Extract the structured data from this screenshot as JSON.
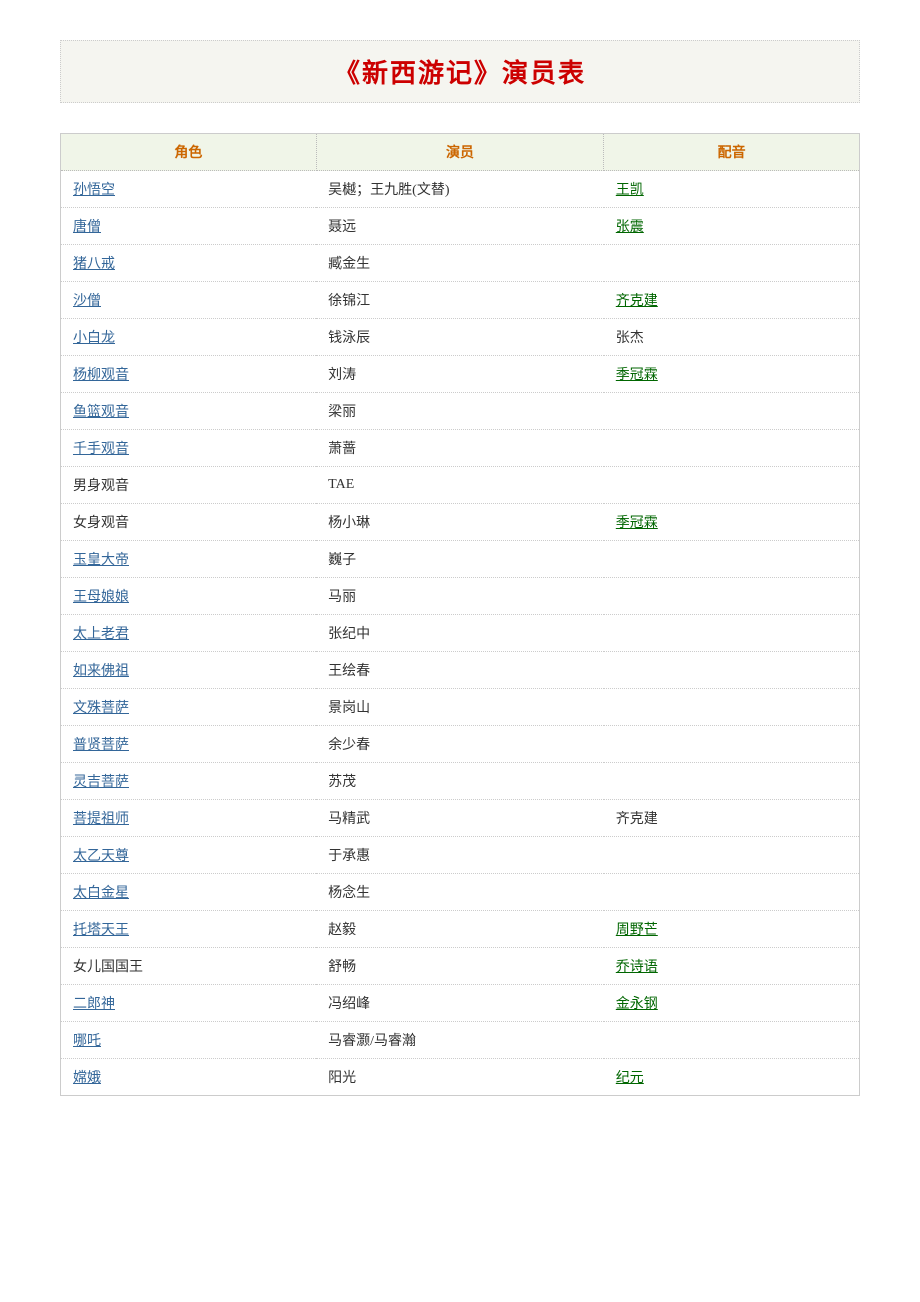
{
  "title": "《新西游记》演员表",
  "table": {
    "headers": [
      "角色",
      "演员",
      "配音"
    ],
    "rows": [
      {
        "role": "孙悟空",
        "role_link": true,
        "actor": "吴樾；王九胜(文替)",
        "actor_link": false,
        "voice": "王凯",
        "voice_link": true
      },
      {
        "role": "唐僧",
        "role_link": true,
        "actor": "聂远",
        "actor_link": false,
        "voice": "张震",
        "voice_link": true
      },
      {
        "role": "猪八戒",
        "role_link": true,
        "actor": "臧金生",
        "actor_link": false,
        "voice": "",
        "voice_link": false
      },
      {
        "role": "沙僧",
        "role_link": true,
        "actor": "徐锦江",
        "actor_link": false,
        "voice": "齐克建",
        "voice_link": true
      },
      {
        "role": "小白龙",
        "role_link": true,
        "actor": "钱泳辰",
        "actor_link": false,
        "voice": "张杰",
        "voice_link": false
      },
      {
        "role": "杨柳观音",
        "role_link": true,
        "actor": "刘涛",
        "actor_link": false,
        "voice": "季冠霖",
        "voice_link": true
      },
      {
        "role": "鱼篮观音",
        "role_link": true,
        "actor": "梁丽",
        "actor_link": false,
        "voice": "",
        "voice_link": false
      },
      {
        "role": "千手观音",
        "role_link": true,
        "actor": "萧蔷",
        "actor_link": false,
        "voice": "",
        "voice_link": false
      },
      {
        "role": "男身观音",
        "role_link": false,
        "actor": "TAE",
        "actor_link": false,
        "voice": "",
        "voice_link": false
      },
      {
        "role": "女身观音",
        "role_link": false,
        "actor": "杨小琳",
        "actor_link": false,
        "voice": "季冠霖",
        "voice_link": true
      },
      {
        "role": "玉皇大帝",
        "role_link": true,
        "actor": "巍子",
        "actor_link": false,
        "voice": "",
        "voice_link": false
      },
      {
        "role": "王母娘娘",
        "role_link": true,
        "actor": "马丽",
        "actor_link": false,
        "voice": "",
        "voice_link": false
      },
      {
        "role": "太上老君",
        "role_link": true,
        "actor": "张纪中",
        "actor_link": false,
        "voice": "",
        "voice_link": false
      },
      {
        "role": "如来佛祖",
        "role_link": true,
        "actor": "王绘春",
        "actor_link": false,
        "voice": "",
        "voice_link": false
      },
      {
        "role": "文殊菩萨",
        "role_link": true,
        "actor": "景岗山",
        "actor_link": false,
        "voice": "",
        "voice_link": false
      },
      {
        "role": "普贤菩萨",
        "role_link": true,
        "actor": "余少春",
        "actor_link": false,
        "voice": "",
        "voice_link": false
      },
      {
        "role": "灵吉菩萨",
        "role_link": true,
        "actor": "苏茂",
        "actor_link": false,
        "voice": "",
        "voice_link": false
      },
      {
        "role": "菩提祖师",
        "role_link": true,
        "actor": "马精武",
        "actor_link": false,
        "voice": "齐克建",
        "voice_link": false
      },
      {
        "role": "太乙天尊",
        "role_link": true,
        "actor": "于承惠",
        "actor_link": false,
        "voice": "",
        "voice_link": false
      },
      {
        "role": "太白金星",
        "role_link": true,
        "actor": "杨念生",
        "actor_link": false,
        "voice": "",
        "voice_link": false
      },
      {
        "role": "托塔天王",
        "role_link": true,
        "actor": "赵毅",
        "actor_link": false,
        "voice": "周野芒",
        "voice_link": true
      },
      {
        "role": "女儿国国王",
        "role_link": false,
        "actor": "舒畅",
        "actor_link": false,
        "voice": "乔诗语",
        "voice_link": true
      },
      {
        "role": "二郎神",
        "role_link": true,
        "actor": "冯绍峰",
        "actor_link": false,
        "voice": "金永钢",
        "voice_link": true
      },
      {
        "role": "哪吒",
        "role_link": true,
        "actor": "马睿灏/马睿瀚",
        "actor_link": false,
        "voice": "",
        "voice_link": false
      },
      {
        "role": "嫦娥",
        "role_link": true,
        "actor": "阳光",
        "actor_link": false,
        "voice": "纪元",
        "voice_link": true
      }
    ]
  }
}
